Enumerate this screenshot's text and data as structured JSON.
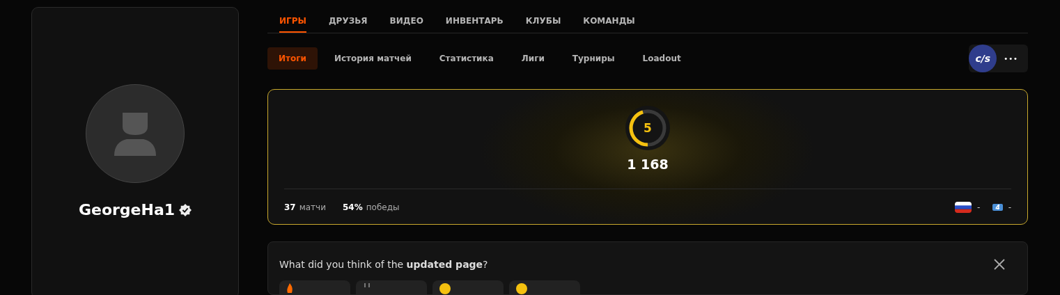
{
  "profile": {
    "username": "GeorgeHa1",
    "verified": true
  },
  "main_tabs": [
    {
      "label": "ИГРЫ",
      "selected": true
    },
    {
      "label": "ДРУЗЬЯ",
      "selected": false
    },
    {
      "label": "ВИДЕО",
      "selected": false
    },
    {
      "label": "ИНВЕНТАРЬ",
      "selected": false
    },
    {
      "label": "КЛУБЫ",
      "selected": false
    },
    {
      "label": "КОМАНДЫ",
      "selected": false
    }
  ],
  "sub_tabs": [
    {
      "label": "Итоги",
      "selected": true
    },
    {
      "label": "История матчей",
      "selected": false
    },
    {
      "label": "Статистика",
      "selected": false
    },
    {
      "label": "Лиги",
      "selected": false
    },
    {
      "label": "Турниры",
      "selected": false
    },
    {
      "label": "Loadout",
      "selected": false
    }
  ],
  "game_badge": {
    "label": "c/s"
  },
  "more_button": {
    "label": "•••"
  },
  "skill": {
    "level_label": "5",
    "level": 0.45,
    "elo": "1 168"
  },
  "stats": [
    {
      "value": "37",
      "label": "матчи"
    },
    {
      "value": "54%",
      "label": "победы"
    }
  ],
  "rankings": [
    {
      "kind": "flag",
      "value": "-"
    },
    {
      "kind": "region",
      "badge": "4",
      "value": "-"
    }
  ],
  "feedback": {
    "question": "What did you think of the **updated page**?",
    "options": [
      {
        "kind": "fire"
      },
      {
        "kind": "neutral"
      },
      {
        "kind": "smile"
      },
      {
        "kind": "smile"
      }
    ]
  }
}
